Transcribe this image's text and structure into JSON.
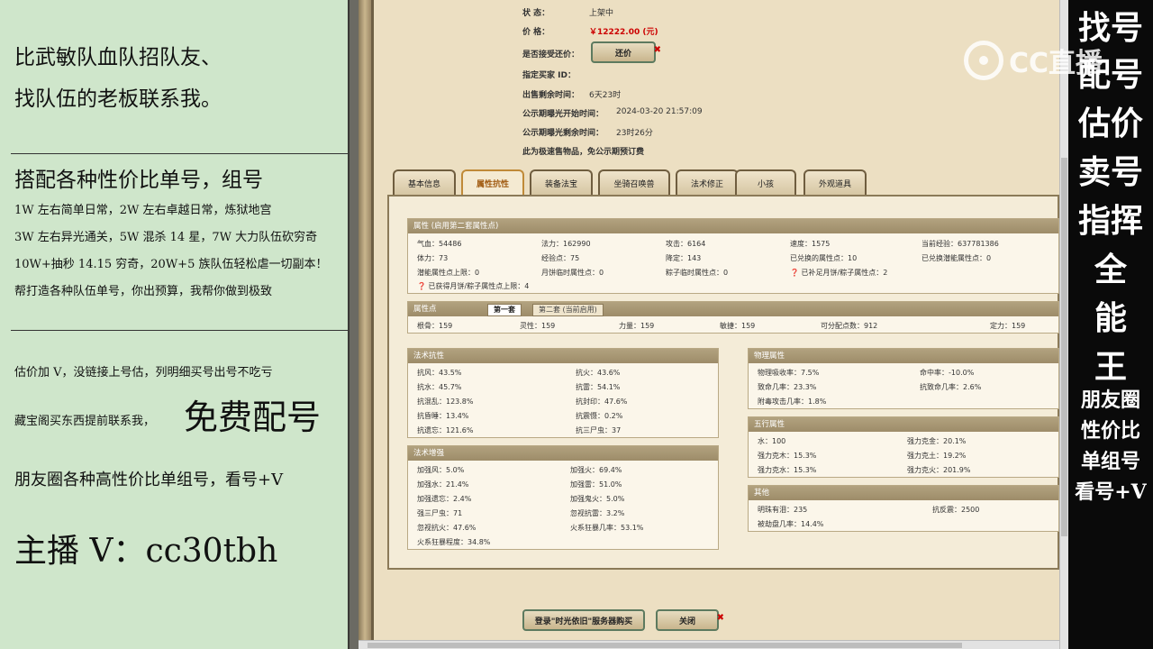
{
  "left_panel": {
    "line1": "比武敏队血队招队友、",
    "line2": "找队伍的老板联系我。",
    "heading": "搭配各种性价比单号，组号",
    "items": [
      "1W 左右简单日常，2W 左右卓越日常，炼狱地宫",
      "3W 左右异光通关，5W 混杀 14 星，7W 大力队伍砍穷奇",
      "10W+抽秒 14.15 穷奇，20W+5 族队伍轻松虐一切副本！",
      "帮打造各种队伍单号，你出预算，我帮你做到极致"
    ],
    "valuation": "估价加 V，没链接上号估，列明细买号出号不吃亏",
    "treasure": "藏宝阁买东西提前联系我，",
    "free": "免费配号",
    "moments": "朋友圈各种高性价比单组号，看号+V",
    "streamer": "主播 V：cc30tbh"
  },
  "listing": {
    "status_label": "状        态：",
    "status_value": "上架中",
    "price_label": "价        格：",
    "price_value": "￥12222.00 (元)",
    "bargain_label": "是否接受还价：",
    "bargain_button": "还价",
    "buyer_label": "指定买家 ID：",
    "remain_label": "出售剩余时间：",
    "remain_value": "6天23时",
    "public_start_label": "公示期曝光开始时间：",
    "public_start_value": "2024-03-20 21:57:09",
    "public_remain_label": "公示期曝光剩余时间：",
    "public_remain_value": "23时26分",
    "note": "此为极速售物品，免公示期预订费"
  },
  "tabs": [
    "基本信息",
    "属性抗性",
    "装备法宝",
    "坐骑召唤兽",
    "法术修正",
    "小孩",
    "外观道具"
  ],
  "attr_box": {
    "title": "属性 (启用第二套属性点)",
    "rows": [
      [
        "气血：54486",
        "法力：162990",
        "攻击：6164",
        "速度：1575",
        "当前经验：637781386"
      ],
      [
        "体力：73",
        "经验点：75",
        "降定：143",
        "已兑换的属性点：10",
        "已兑换潜能属性点：0"
      ],
      [
        "潜能属性点上限：0",
        "月饼临时属性点：0",
        "粽子临时属性点：0",
        "已补足月饼/粽子属性点：2",
        ""
      ]
    ],
    "footnote": "已获得月饼/粽子属性点上限：4"
  },
  "points_box": {
    "title": "属性点",
    "subtab1": "第一套",
    "subtab2": "第二套 (当前启用)",
    "row": [
      "根骨：159",
      "灵性：159",
      "力量：159",
      "敏捷：159",
      "可分配点数：912",
      "定力：159"
    ]
  },
  "resist_box": {
    "title": "法术抗性",
    "cells": [
      [
        "抗风：43.5%",
        "抗火：43.6%"
      ],
      [
        "抗水：45.7%",
        "抗雷：54.1%"
      ],
      [
        "抗混乱：123.8%",
        "抗封印：47.6%"
      ],
      [
        "抗昏睡：13.4%",
        "抗震慑：0.2%"
      ],
      [
        "抗遗忘：121.6%",
        "抗三尸虫：37"
      ]
    ]
  },
  "boost_box": {
    "title": "法术增强",
    "cells": [
      [
        "加强风：5.0%",
        "加强火：69.4%"
      ],
      [
        "加强水：21.4%",
        "加强雷：51.0%"
      ],
      [
        "加强遗忘：2.4%",
        "加强鬼火：5.0%"
      ],
      [
        "强三尸虫：71",
        "忽视抗雷：3.2%"
      ],
      [
        "忽视抗火：47.6%",
        "火系狂暴几率：53.1%"
      ],
      [
        "火系狂暴程度：34.8%",
        ""
      ]
    ]
  },
  "physical_box": {
    "title": "物理属性",
    "cells": [
      [
        "物理吸收率：7.5%",
        "命中率：-10.0%"
      ],
      [
        "致命几率：23.3%",
        "抗致命几率：2.6%"
      ],
      [
        "附毒攻击几率：1.8%",
        ""
      ]
    ]
  },
  "element_box": {
    "title": "五行属性",
    "cells": [
      [
        "水：100",
        "强力克金：20.1%"
      ],
      [
        "强力克木：15.3%",
        "强力克土：19.2%"
      ],
      [
        "强力克水：15.3%",
        "强力克火：201.9%"
      ]
    ]
  },
  "other_box": {
    "title": "其他",
    "cells": [
      [
        "明珠有泪：235",
        "抗反震：2500"
      ],
      [
        "被劫盘几率：14.4%",
        ""
      ]
    ]
  },
  "bottom_buttons": {
    "login": "登录\"时光依旧\"服务器购买",
    "close": "关闭"
  },
  "right_banner": {
    "big_lines": [
      "找号",
      "配号",
      "估价",
      "卖号",
      "指挥",
      "全",
      "能",
      "王"
    ],
    "small_lines": [
      "朋友圈",
      "性价比",
      "单组号",
      "看号+V"
    ]
  },
  "logo_text": "CC直播"
}
